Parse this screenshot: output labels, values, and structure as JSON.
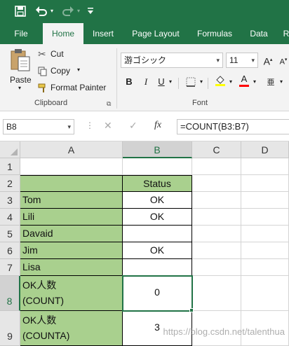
{
  "qat": {
    "save_icon": "save-icon",
    "undo_icon": "undo-icon",
    "redo_icon": "redo-icon",
    "customize_icon": "customize-icon"
  },
  "tabs": [
    {
      "label": "File"
    },
    {
      "label": "Home",
      "active": true
    },
    {
      "label": "Insert"
    },
    {
      "label": "Page Layout"
    },
    {
      "label": "Formulas"
    },
    {
      "label": "Data"
    },
    {
      "label": "R"
    }
  ],
  "clipboard": {
    "paste_label": "Paste",
    "cut_label": "Cut",
    "copy_label": "Copy",
    "format_painter_label": "Format Painter",
    "group_label": "Clipboard"
  },
  "font": {
    "font_name": "游ゴシック",
    "font_size": "11",
    "bold": "B",
    "italic": "I",
    "underline": "U",
    "grow": "A",
    "shrink": "A",
    "font_color_letter": "A",
    "group_label": "Font"
  },
  "formula_bar": {
    "name_box": "B8",
    "fx": "fx",
    "formula": "=COUNT(B3:B7)"
  },
  "grid": {
    "columns": [
      "A",
      "B",
      "C",
      "D"
    ],
    "selected_column": "B",
    "rows": [
      {
        "num": "1",
        "a": "",
        "b": ""
      },
      {
        "num": "2",
        "a": "",
        "b": "Status"
      },
      {
        "num": "3",
        "a": "Tom",
        "b": "OK"
      },
      {
        "num": "4",
        "a": "Lili",
        "b": "OK"
      },
      {
        "num": "5",
        "a": "Davaid",
        "b": ""
      },
      {
        "num": "6",
        "a": "Jim",
        "b": "OK"
      },
      {
        "num": "7",
        "a": "Lisa",
        "b": ""
      },
      {
        "num": "8",
        "a_line1": "OK人数",
        "a_line2": "(COUNT)",
        "b": "0"
      },
      {
        "num": "9",
        "a_line1": "OK人数",
        "a_line2": "(COUNTA)",
        "b": "3"
      }
    ],
    "selected_cell": "B8",
    "accent_color": "#217346",
    "fill_color": "#a9d08e"
  },
  "watermark": "https://blog.csdn.net/talenthua"
}
